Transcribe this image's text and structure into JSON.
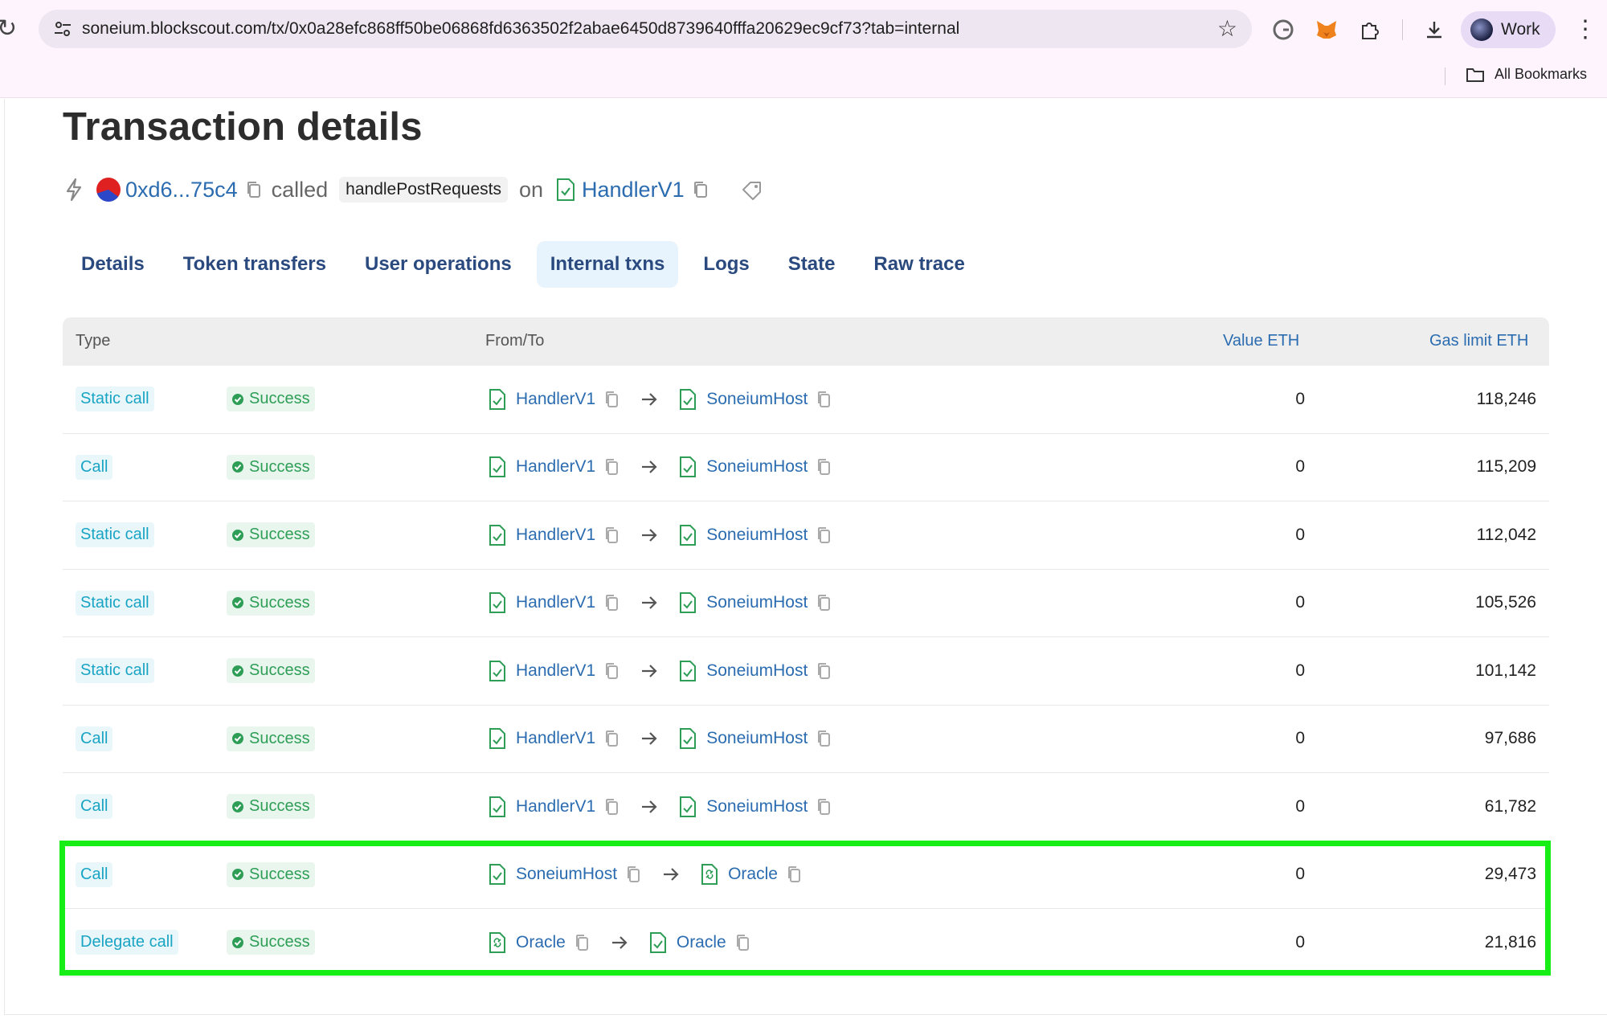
{
  "browser": {
    "url_host": "soneium.blockscout.com",
    "url_path": "/tx/0x0a28efc868ff50be06868fd6363502f2abae6450d8739640fffa20629ec9cf73?tab=internal",
    "profile_label": "Work",
    "bookmarks_label": "All Bookmarks"
  },
  "page": {
    "title": "Transaction details",
    "sender": "0xd6...75c4",
    "called_label": "called",
    "method": "handlePostRequests",
    "on_label": "on",
    "contract": "HandlerV1"
  },
  "tabs": [
    "Details",
    "Token transfers",
    "User operations",
    "Internal txns",
    "Logs",
    "State",
    "Raw trace"
  ],
  "active_tab": "Internal txns",
  "table": {
    "headers": {
      "type": "Type",
      "from_to": "From/To",
      "value": "Value ETH",
      "gas": "Gas limit ETH"
    },
    "rows": [
      {
        "type": "Static call",
        "status": "Success",
        "from": "HandlerV1",
        "to": "SoneiumHost",
        "value": "0",
        "gas": "118,246"
      },
      {
        "type": "Call",
        "status": "Success",
        "from": "HandlerV1",
        "to": "SoneiumHost",
        "value": "0",
        "gas": "115,209"
      },
      {
        "type": "Static call",
        "status": "Success",
        "from": "HandlerV1",
        "to": "SoneiumHost",
        "value": "0",
        "gas": "112,042"
      },
      {
        "type": "Static call",
        "status": "Success",
        "from": "HandlerV1",
        "to": "SoneiumHost",
        "value": "0",
        "gas": "105,526"
      },
      {
        "type": "Static call",
        "status": "Success",
        "from": "HandlerV1",
        "to": "SoneiumHost",
        "value": "0",
        "gas": "101,142"
      },
      {
        "type": "Call",
        "status": "Success",
        "from": "HandlerV1",
        "to": "SoneiumHost",
        "value": "0",
        "gas": "97,686"
      },
      {
        "type": "Call",
        "status": "Success",
        "from": "HandlerV1",
        "to": "SoneiumHost",
        "value": "0",
        "gas": "61,782"
      },
      {
        "type": "Call",
        "status": "Success",
        "from": "SoneiumHost",
        "to": "Oracle",
        "value": "0",
        "gas": "29,473"
      },
      {
        "type": "Delegate call",
        "status": "Success",
        "from": "Oracle",
        "to": "Oracle",
        "value": "0",
        "gas": "21,816"
      }
    ]
  },
  "colors": {
    "link": "#2b6cb0",
    "type_badge": "#1aa4c4",
    "success": "#2e9e57",
    "highlight": "#16ee16"
  }
}
